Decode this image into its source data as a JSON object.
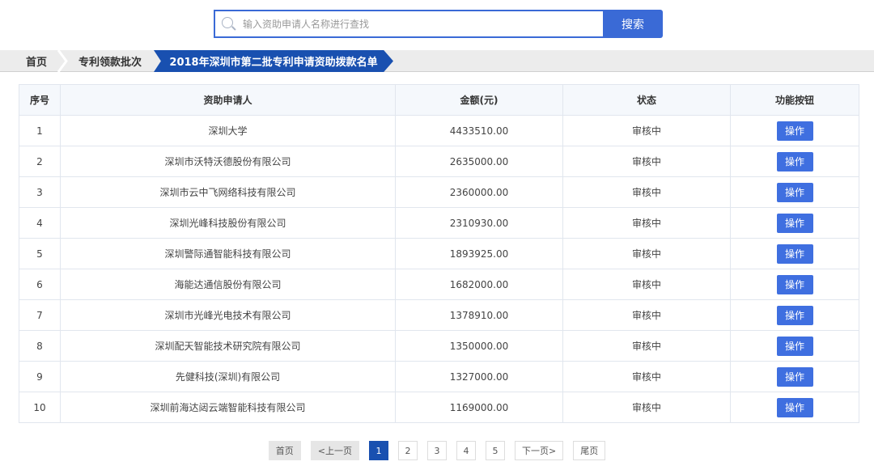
{
  "search": {
    "placeholder": "输入资助申请人名称进行查找",
    "button_label": "搜索"
  },
  "breadcrumb": {
    "home": "首页",
    "batch": "专利领款批次",
    "current": "2018年深圳市第二批专利申请资助拨款名单"
  },
  "table": {
    "headers": [
      "序号",
      "资助申请人",
      "金额(元)",
      "状态",
      "功能按钮"
    ],
    "rows": [
      {
        "no": "1",
        "name": "深圳大学",
        "amount": "4433510.00",
        "status": "审核中",
        "action": "操作"
      },
      {
        "no": "2",
        "name": "深圳市沃特沃德股份有限公司",
        "amount": "2635000.00",
        "status": "审核中",
        "action": "操作"
      },
      {
        "no": "3",
        "name": "深圳市云中飞网络科技有限公司",
        "amount": "2360000.00",
        "status": "审核中",
        "action": "操作"
      },
      {
        "no": "4",
        "name": "深圳光峰科技股份有限公司",
        "amount": "2310930.00",
        "status": "审核中",
        "action": "操作"
      },
      {
        "no": "5",
        "name": "深圳警际通智能科技有限公司",
        "amount": "1893925.00",
        "status": "审核中",
        "action": "操作"
      },
      {
        "no": "6",
        "name": "海能达通信股份有限公司",
        "amount": "1682000.00",
        "status": "审核中",
        "action": "操作"
      },
      {
        "no": "7",
        "name": "深圳市光峰光电技术有限公司",
        "amount": "1378910.00",
        "status": "审核中",
        "action": "操作"
      },
      {
        "no": "8",
        "name": "深圳配天智能技术研究院有限公司",
        "amount": "1350000.00",
        "status": "审核中",
        "action": "操作"
      },
      {
        "no": "9",
        "name": "先健科技(深圳)有限公司",
        "amount": "1327000.00",
        "status": "审核中",
        "action": "操作"
      },
      {
        "no": "10",
        "name": "深圳前海达闼云端智能科技有限公司",
        "amount": "1169000.00",
        "status": "审核中",
        "action": "操作"
      }
    ]
  },
  "pagination": {
    "first": "首页",
    "prev": "<上一页",
    "pages": [
      "1",
      "2",
      "3",
      "4",
      "5"
    ],
    "current": "1",
    "next": "下一页>",
    "last": "尾页"
  },
  "colors": {
    "accent": "#1950b0",
    "button": "#3f6fe0",
    "search_border": "#3a6ad6"
  }
}
